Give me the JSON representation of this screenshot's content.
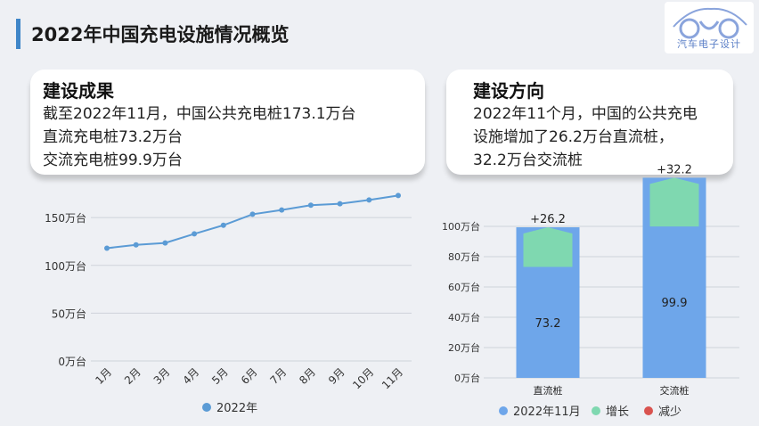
{
  "header": {
    "title": "2022年中国充电设施情况概览"
  },
  "logo": {
    "text": "汽车电子设计"
  },
  "cards": {
    "left": {
      "title": "建设成果",
      "lines": [
        "截至2022年11月，中国公共充电桩173.1万台",
        "直流充电桩73.2万台",
        "交流充电桩99.9万台"
      ]
    },
    "right": {
      "title": "建设方向",
      "lines": [
        "2022年11个月，中国的公共充电",
        "设施增加了26.2万台直流桩，",
        "32.2万台交流桩"
      ]
    }
  },
  "chart_data": [
    {
      "type": "line",
      "categories": [
        "1月",
        "2月",
        "3月",
        "4月",
        "5月",
        "6月",
        "7月",
        "8月",
        "9月",
        "10月",
        "11月"
      ],
      "series": [
        {
          "name": "2022年",
          "values": [
            118,
            121.5,
            123.5,
            133,
            142,
            153.5,
            158,
            163,
            164.5,
            168.5,
            173.1
          ],
          "color": "#5b9bd5"
        }
      ],
      "yticks": [
        "0万台",
        "50万台",
        "100万台",
        "150万台"
      ],
      "ylim": [
        0,
        180
      ],
      "grid": true,
      "legend": "bottom"
    },
    {
      "type": "bar",
      "categories": [
        "直流桩",
        "交流桩"
      ],
      "series": [
        {
          "name": "2022年11月",
          "values": [
            73.2,
            99.9
          ],
          "color": "#6ea6ea"
        },
        {
          "name": "增长",
          "values": [
            26.2,
            32.2
          ],
          "color": "#7fd8b0"
        },
        {
          "name": "减少",
          "values": [
            0,
            0
          ],
          "color": "#d9534f"
        }
      ],
      "bar_labels": [
        "73.2",
        "99.9"
      ],
      "growth_labels": [
        "+26.2",
        "+32.2"
      ],
      "yticks": [
        "0万台",
        "20万台",
        "40万台",
        "60万台",
        "80万台",
        "100万台"
      ],
      "ylim": [
        0,
        100
      ],
      "grid": true,
      "legend": "bottom"
    }
  ]
}
